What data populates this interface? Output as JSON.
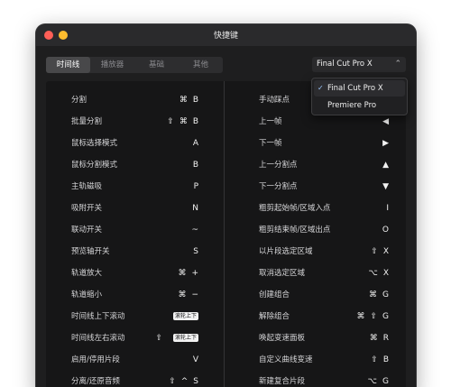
{
  "window": {
    "title": "快捷键"
  },
  "tabs": [
    "时间线",
    "播放器",
    "基础",
    "其他"
  ],
  "preset": {
    "selected": "Final Cut Pro X",
    "options": [
      "Final Cut Pro X",
      "Premiere Pro"
    ]
  },
  "left_shortcuts": [
    {
      "label": "分割",
      "keys": [
        "⌘",
        "B"
      ]
    },
    {
      "label": "批量分割",
      "keys": [
        "⇧",
        "⌘",
        "B"
      ]
    },
    {
      "label": "鼠标选择模式",
      "keys": [
        "A"
      ]
    },
    {
      "label": "鼠标分割模式",
      "keys": [
        "B"
      ]
    },
    {
      "label": "主轨磁吸",
      "keys": [
        "P"
      ]
    },
    {
      "label": "吸附开关",
      "keys": [
        "N"
      ]
    },
    {
      "label": "联动开关",
      "keys": [
        "~"
      ]
    },
    {
      "label": "预览轴开关",
      "keys": [
        "S"
      ]
    },
    {
      "label": "轨道放大",
      "keys": [
        "⌘",
        "+"
      ]
    },
    {
      "label": "轨道缩小",
      "keys": [
        "⌘",
        "−"
      ]
    },
    {
      "label": "时间线上下滚动",
      "keys": [],
      "pill": "滚轮上下"
    },
    {
      "label": "时间线左右滚动",
      "keys": [
        "⇧"
      ],
      "pill": "滚轮上下"
    },
    {
      "label": "启用/停用片段",
      "keys": [
        "V"
      ]
    },
    {
      "label": "分离/还原音频",
      "keys": [
        "⇧",
        "^",
        "S"
      ]
    }
  ],
  "right_shortcuts": [
    {
      "label": "手动踩点",
      "keys": []
    },
    {
      "label": "上一帧",
      "keys": [
        "◀"
      ]
    },
    {
      "label": "下一帧",
      "keys": [
        "▶"
      ]
    },
    {
      "label": "上一分割点",
      "keys": [
        "▲"
      ]
    },
    {
      "label": "下一分割点",
      "keys": [
        "▼"
      ]
    },
    {
      "label": "粗剪起始帧/区域入点",
      "keys": [
        "I"
      ]
    },
    {
      "label": "粗剪结束帧/区域出点",
      "keys": [
        "O"
      ]
    },
    {
      "label": "以片段选定区域",
      "keys": [
        "⇧",
        "X"
      ]
    },
    {
      "label": "取消选定区域",
      "keys": [
        "⌥",
        "X"
      ]
    },
    {
      "label": "创建组合",
      "keys": [
        "⌘",
        "G"
      ]
    },
    {
      "label": "解除组合",
      "keys": [
        "⌘",
        "⇧",
        "G"
      ]
    },
    {
      "label": "唤起变速面板",
      "keys": [
        "⌘",
        "R"
      ]
    },
    {
      "label": "自定义曲线变速",
      "keys": [
        "⇧",
        "B"
      ]
    },
    {
      "label": "新建复合片段",
      "keys": [
        "⌥",
        "G"
      ]
    }
  ]
}
